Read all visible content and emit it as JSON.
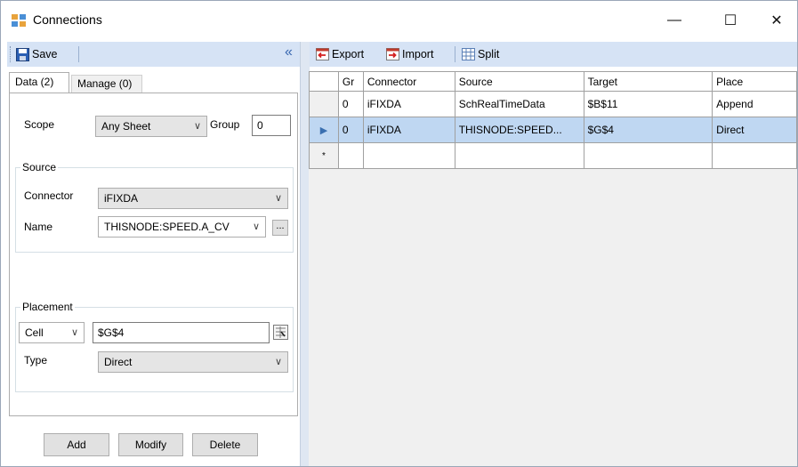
{
  "window": {
    "title": "Connections",
    "minimize_glyph": "—",
    "maximize_glyph": "☐",
    "close_glyph": "✕"
  },
  "left_toolbar": {
    "save_label": "Save",
    "collapse_glyph": "«"
  },
  "right_toolbar": {
    "export_label": "Export",
    "import_label": "Import",
    "split_label": "Split"
  },
  "tabs": [
    {
      "label": "Data (2)"
    },
    {
      "label": "Manage (0)"
    }
  ],
  "form": {
    "scope_label": "Scope",
    "scope_value": "Any Sheet",
    "group_label": "Group",
    "group_value": "0",
    "source_title": "Source",
    "connector_label": "Connector",
    "connector_value": "iFIXDA",
    "name_label": "Name",
    "name_value": "THISNODE:SPEED.A_CV",
    "browse_label": "...",
    "placement_title": "Placement",
    "placement_mode": "Cell",
    "placement_value": "$G$4",
    "type_label": "Type",
    "type_value": "Direct"
  },
  "buttons": {
    "add": "Add",
    "modify": "Modify",
    "delete": "Delete"
  },
  "grid": {
    "columns": [
      "Gr",
      "Connector",
      "Source",
      "Target",
      "Place"
    ],
    "rows": [
      {
        "cells": [
          "0",
          "iFIXDA",
          "SchRealTimeData",
          "$B$11",
          "Append"
        ]
      },
      {
        "cells": [
          "0",
          "iFIXDA",
          "THISNODE:SPEED...",
          "$G$4",
          "Direct"
        ]
      }
    ],
    "current_row_marker": "▶",
    "new_row_marker": "*"
  },
  "colors": {
    "toolbar_bg": "#d6e3f5",
    "selected_row": "#bfd7f2"
  }
}
